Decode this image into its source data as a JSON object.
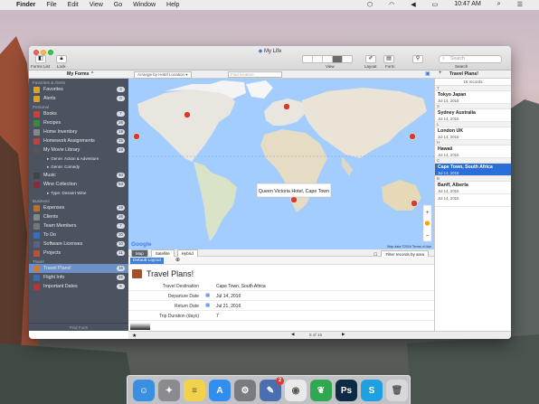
{
  "menubar": {
    "apple": "",
    "items": [
      "Finder",
      "File",
      "Edit",
      "View",
      "Go",
      "Window",
      "Help"
    ],
    "clock": "10:47 AM"
  },
  "window": {
    "title": "My Life",
    "toolbar": {
      "forms_list": "Forms List",
      "lock": "Lock",
      "view": "View",
      "layout": "Layout",
      "form": "Form",
      "search_label": "Search",
      "search_placeholder": "Search"
    },
    "subbar": {
      "form_selector": "My Forms",
      "arrange": "Arrange by Hotel Location",
      "find_location": "Find location",
      "list_title": "Travel Plans!",
      "record_count": "16 records"
    }
  },
  "sidebar": {
    "sections": [
      {
        "title": "Favorites & Alerts",
        "items": [
          {
            "label": "Favorites",
            "count": "3",
            "color": "#e0a020"
          },
          {
            "label": "Alerts",
            "count": "0",
            "color": "#e0a020"
          }
        ]
      },
      {
        "title": "Personal",
        "items": [
          {
            "label": "Books",
            "count": "7",
            "color": "#d04030"
          },
          {
            "label": "Recipes",
            "count": "26",
            "color": "#3a8a3a"
          },
          {
            "label": "Home Inventory",
            "count": "19",
            "color": "#888"
          },
          {
            "label": "Homework Assignments",
            "count": "15",
            "color": "#c04040"
          },
          {
            "label": "My Movie Library",
            "count": "18",
            "color": "#555"
          },
          {
            "label": "Genre: Action & Adventure",
            "count": "",
            "color": "",
            "sub": true
          },
          {
            "label": "Genre: Comedy",
            "count": "",
            "color": "",
            "sub": true
          },
          {
            "label": "Music",
            "count": "40",
            "color": "#444"
          },
          {
            "label": "Wine Collection",
            "count": "53",
            "color": "#8a2a3a"
          },
          {
            "label": "Type: Dessert Wine",
            "count": "",
            "color": "",
            "sub": true
          }
        ]
      },
      {
        "title": "Business",
        "items": [
          {
            "label": "Expenses",
            "count": "19",
            "color": "#c07020"
          },
          {
            "label": "Clients",
            "count": "26",
            "color": "#888"
          },
          {
            "label": "Team Members",
            "count": "7",
            "color": "#777"
          },
          {
            "label": "To Do",
            "count": "20",
            "color": "#3070c0"
          },
          {
            "label": "Software Licenses",
            "count": "10",
            "color": "#606080"
          },
          {
            "label": "Projects",
            "count": "11",
            "color": "#c05030"
          }
        ]
      },
      {
        "title": "Travel",
        "items": [
          {
            "label": "Travel Plans!",
            "count": "16",
            "color": "#d07a2a",
            "selected": true
          },
          {
            "label": "Flight Info",
            "count": "22",
            "color": "#3a6ab0"
          },
          {
            "label": "Important Dates",
            "count": "5",
            "color": "#c03030"
          }
        ]
      }
    ],
    "footer": "Find Form"
  },
  "map": {
    "popup": "Queen Victoria Hotel, Cape Town",
    "google": "Google",
    "attribution": "Map data ©2016  Terms of Use",
    "tabs": [
      "Map",
      "Satellite",
      "Hybrid"
    ],
    "filter_label": "Filter records by area"
  },
  "detail": {
    "layout_tab": "Default Layout",
    "form_title": "Travel Plans!",
    "fields": [
      {
        "label": "Travel Destination",
        "value": "Cape Town, South Africa"
      },
      {
        "label": "Departure Date",
        "value": "Jul 14, 2016"
      },
      {
        "label": "Return Date",
        "value": "Jul 21, 2016"
      },
      {
        "label": "Trip Duration (days)",
        "value": "7"
      }
    ]
  },
  "records": {
    "sections": [
      {
        "letter": "T",
        "items": [
          {
            "title": "Tokyo Japan",
            "date": "Jul 14, 2016"
          }
        ]
      },
      {
        "letter": "S",
        "items": [
          {
            "title": "Sydney Australia",
            "date": "Jul 14, 2016"
          }
        ]
      },
      {
        "letter": "L",
        "items": [
          {
            "title": "London UK",
            "date": "Jul 14, 2016"
          }
        ]
      },
      {
        "letter": "H",
        "items": [
          {
            "title": "Hawaii",
            "date": "Jul 14, 2016"
          }
        ]
      },
      {
        "letter": "C",
        "items": [
          {
            "title": "Cape Town, South Africa",
            "date": "Jul 14, 2016",
            "selected": true
          }
        ]
      },
      {
        "letter": "B",
        "items": [
          {
            "title": "Banff, Alberta",
            "date": "Jul 14, 2016"
          }
        ]
      },
      {
        "letter": "",
        "items": [
          {
            "title": "",
            "date": "Jul 14, 2016"
          }
        ]
      }
    ],
    "pager": "5 of 16"
  },
  "dock": [
    {
      "name": "finder-icon",
      "color": "#3b8fe0",
      "glyph": "☺"
    },
    {
      "name": "launchpad-icon",
      "color": "#8a8a90",
      "glyph": "✦"
    },
    {
      "name": "notes-icon",
      "color": "#f2d24a",
      "glyph": "≡"
    },
    {
      "name": "app-store-icon",
      "color": "#2f8ef0",
      "glyph": "A"
    },
    {
      "name": "system-preferences-icon",
      "color": "#7a7a80",
      "glyph": "⚙"
    },
    {
      "name": "tap-forms-icon",
      "color": "#4a6fb0",
      "glyph": "✎"
    },
    {
      "name": "chrome-icon",
      "color": "#e9e9e9",
      "glyph": "◉"
    },
    {
      "name": "evernote-icon",
      "color": "#2fa84f",
      "glyph": "❦"
    },
    {
      "name": "photoshop-icon",
      "color": "#0f2a44",
      "glyph": "Ps"
    },
    {
      "name": "skype-icon",
      "color": "#1fa0e0",
      "glyph": "S"
    },
    {
      "name": "trash-icon",
      "color": "#d8d8dc",
      "glyph": "🗑"
    }
  ],
  "dock_badge": "2"
}
